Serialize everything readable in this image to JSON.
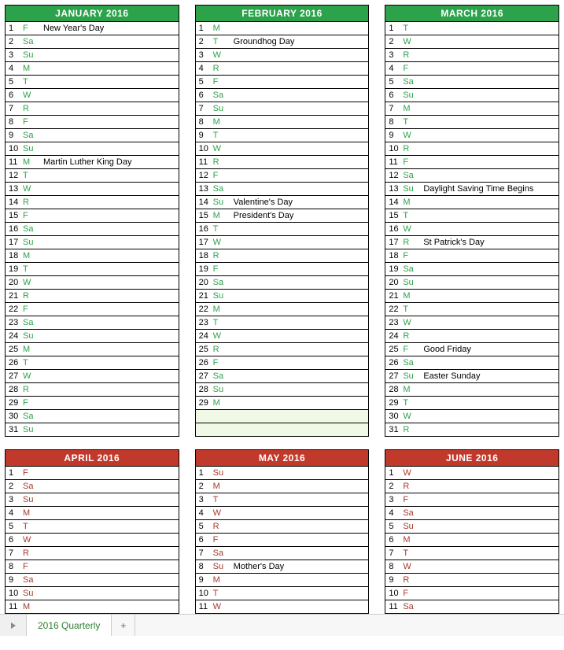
{
  "sheet_tab": "2016 Quarterly",
  "rows_q1": [
    {
      "top": [
        {
          "title": "JANUARY 2016",
          "hdr": "hdr-green",
          "wd": "wd-green",
          "fill": 31,
          "days": [
            {
              "n": 1,
              "w": "F",
              "e": "New Year's Day"
            },
            {
              "n": 2,
              "w": "Sa",
              "e": ""
            },
            {
              "n": 3,
              "w": "Su",
              "e": ""
            },
            {
              "n": 4,
              "w": "M",
              "e": ""
            },
            {
              "n": 5,
              "w": "T",
              "e": ""
            },
            {
              "n": 6,
              "w": "W",
              "e": ""
            },
            {
              "n": 7,
              "w": "R",
              "e": ""
            },
            {
              "n": 8,
              "w": "F",
              "e": ""
            },
            {
              "n": 9,
              "w": "Sa",
              "e": ""
            },
            {
              "n": 10,
              "w": "Su",
              "e": ""
            },
            {
              "n": 11,
              "w": "M",
              "e": "Martin Luther King Day"
            },
            {
              "n": 12,
              "w": "T",
              "e": ""
            },
            {
              "n": 13,
              "w": "W",
              "e": ""
            },
            {
              "n": 14,
              "w": "R",
              "e": ""
            },
            {
              "n": 15,
              "w": "F",
              "e": ""
            },
            {
              "n": 16,
              "w": "Sa",
              "e": ""
            },
            {
              "n": 17,
              "w": "Su",
              "e": ""
            },
            {
              "n": 18,
              "w": "M",
              "e": ""
            },
            {
              "n": 19,
              "w": "T",
              "e": ""
            },
            {
              "n": 20,
              "w": "W",
              "e": ""
            },
            {
              "n": 21,
              "w": "R",
              "e": ""
            },
            {
              "n": 22,
              "w": "F",
              "e": ""
            },
            {
              "n": 23,
              "w": "Sa",
              "e": ""
            },
            {
              "n": 24,
              "w": "Su",
              "e": ""
            },
            {
              "n": 25,
              "w": "M",
              "e": ""
            },
            {
              "n": 26,
              "w": "T",
              "e": ""
            },
            {
              "n": 27,
              "w": "W",
              "e": ""
            },
            {
              "n": 28,
              "w": "R",
              "e": ""
            },
            {
              "n": 29,
              "w": "F",
              "e": ""
            },
            {
              "n": 30,
              "w": "Sa",
              "e": ""
            },
            {
              "n": 31,
              "w": "Su",
              "e": ""
            }
          ]
        },
        {
          "title": "FEBRUARY 2016",
          "hdr": "hdr-green",
          "wd": "wd-green",
          "fill": 31,
          "days": [
            {
              "n": 1,
              "w": "M",
              "e": ""
            },
            {
              "n": 2,
              "w": "T",
              "e": "Groundhog Day"
            },
            {
              "n": 3,
              "w": "W",
              "e": ""
            },
            {
              "n": 4,
              "w": "R",
              "e": ""
            },
            {
              "n": 5,
              "w": "F",
              "e": ""
            },
            {
              "n": 6,
              "w": "Sa",
              "e": ""
            },
            {
              "n": 7,
              "w": "Su",
              "e": ""
            },
            {
              "n": 8,
              "w": "M",
              "e": ""
            },
            {
              "n": 9,
              "w": "T",
              "e": ""
            },
            {
              "n": 10,
              "w": "W",
              "e": ""
            },
            {
              "n": 11,
              "w": "R",
              "e": ""
            },
            {
              "n": 12,
              "w": "F",
              "e": ""
            },
            {
              "n": 13,
              "w": "Sa",
              "e": ""
            },
            {
              "n": 14,
              "w": "Su",
              "e": "Valentine's Day"
            },
            {
              "n": 15,
              "w": "M",
              "e": "President's Day"
            },
            {
              "n": 16,
              "w": "T",
              "e": ""
            },
            {
              "n": 17,
              "w": "W",
              "e": ""
            },
            {
              "n": 18,
              "w": "R",
              "e": ""
            },
            {
              "n": 19,
              "w": "F",
              "e": ""
            },
            {
              "n": 20,
              "w": "Sa",
              "e": ""
            },
            {
              "n": 21,
              "w": "Su",
              "e": ""
            },
            {
              "n": 22,
              "w": "M",
              "e": ""
            },
            {
              "n": 23,
              "w": "T",
              "e": ""
            },
            {
              "n": 24,
              "w": "W",
              "e": ""
            },
            {
              "n": 25,
              "w": "R",
              "e": ""
            },
            {
              "n": 26,
              "w": "F",
              "e": ""
            },
            {
              "n": 27,
              "w": "Sa",
              "e": ""
            },
            {
              "n": 28,
              "w": "Su",
              "e": ""
            },
            {
              "n": 29,
              "w": "M",
              "e": ""
            }
          ]
        },
        {
          "title": "MARCH 2016",
          "hdr": "hdr-green",
          "wd": "wd-green",
          "fill": 31,
          "days": [
            {
              "n": 1,
              "w": "T",
              "e": ""
            },
            {
              "n": 2,
              "w": "W",
              "e": ""
            },
            {
              "n": 3,
              "w": "R",
              "e": ""
            },
            {
              "n": 4,
              "w": "F",
              "e": ""
            },
            {
              "n": 5,
              "w": "Sa",
              "e": ""
            },
            {
              "n": 6,
              "w": "Su",
              "e": ""
            },
            {
              "n": 7,
              "w": "M",
              "e": ""
            },
            {
              "n": 8,
              "w": "T",
              "e": ""
            },
            {
              "n": 9,
              "w": "W",
              "e": ""
            },
            {
              "n": 10,
              "w": "R",
              "e": ""
            },
            {
              "n": 11,
              "w": "F",
              "e": ""
            },
            {
              "n": 12,
              "w": "Sa",
              "e": ""
            },
            {
              "n": 13,
              "w": "Su",
              "e": "Daylight Saving Time Begins"
            },
            {
              "n": 14,
              "w": "M",
              "e": ""
            },
            {
              "n": 15,
              "w": "T",
              "e": ""
            },
            {
              "n": 16,
              "w": "W",
              "e": ""
            },
            {
              "n": 17,
              "w": "R",
              "e": "St Patrick's Day"
            },
            {
              "n": 18,
              "w": "F",
              "e": ""
            },
            {
              "n": 19,
              "w": "Sa",
              "e": ""
            },
            {
              "n": 20,
              "w": "Su",
              "e": ""
            },
            {
              "n": 21,
              "w": "M",
              "e": ""
            },
            {
              "n": 22,
              "w": "T",
              "e": ""
            },
            {
              "n": 23,
              "w": "W",
              "e": ""
            },
            {
              "n": 24,
              "w": "R",
              "e": ""
            },
            {
              "n": 25,
              "w": "F",
              "e": "Good Friday"
            },
            {
              "n": 26,
              "w": "Sa",
              "e": ""
            },
            {
              "n": 27,
              "w": "Su",
              "e": "Easter Sunday"
            },
            {
              "n": 28,
              "w": "M",
              "e": ""
            },
            {
              "n": 29,
              "w": "T",
              "e": ""
            },
            {
              "n": 30,
              "w": "W",
              "e": ""
            },
            {
              "n": 31,
              "w": "R",
              "e": ""
            }
          ]
        }
      ]
    },
    {
      "top": [
        {
          "title": "APRIL 2016",
          "hdr": "hdr-red",
          "wd": "wd-red",
          "fill": 11,
          "days": [
            {
              "n": 1,
              "w": "F",
              "e": ""
            },
            {
              "n": 2,
              "w": "Sa",
              "e": ""
            },
            {
              "n": 3,
              "w": "Su",
              "e": ""
            },
            {
              "n": 4,
              "w": "M",
              "e": ""
            },
            {
              "n": 5,
              "w": "T",
              "e": ""
            },
            {
              "n": 6,
              "w": "W",
              "e": ""
            },
            {
              "n": 7,
              "w": "R",
              "e": ""
            },
            {
              "n": 8,
              "w": "F",
              "e": ""
            },
            {
              "n": 9,
              "w": "Sa",
              "e": ""
            },
            {
              "n": 10,
              "w": "Su",
              "e": ""
            },
            {
              "n": 11,
              "w": "M",
              "e": ""
            }
          ]
        },
        {
          "title": "MAY 2016",
          "hdr": "hdr-red",
          "wd": "wd-red",
          "fill": 11,
          "days": [
            {
              "n": 1,
              "w": "Su",
              "e": ""
            },
            {
              "n": 2,
              "w": "M",
              "e": ""
            },
            {
              "n": 3,
              "w": "T",
              "e": ""
            },
            {
              "n": 4,
              "w": "W",
              "e": ""
            },
            {
              "n": 5,
              "w": "R",
              "e": ""
            },
            {
              "n": 6,
              "w": "F",
              "e": ""
            },
            {
              "n": 7,
              "w": "Sa",
              "e": ""
            },
            {
              "n": 8,
              "w": "Su",
              "e": "Mother's Day"
            },
            {
              "n": 9,
              "w": "M",
              "e": ""
            },
            {
              "n": 10,
              "w": "T",
              "e": ""
            },
            {
              "n": 11,
              "w": "W",
              "e": ""
            }
          ]
        },
        {
          "title": "JUNE 2016",
          "hdr": "hdr-red",
          "wd": "wd-red",
          "fill": 11,
          "days": [
            {
              "n": 1,
              "w": "W",
              "e": ""
            },
            {
              "n": 2,
              "w": "R",
              "e": ""
            },
            {
              "n": 3,
              "w": "F",
              "e": ""
            },
            {
              "n": 4,
              "w": "Sa",
              "e": ""
            },
            {
              "n": 5,
              "w": "Su",
              "e": ""
            },
            {
              "n": 6,
              "w": "M",
              "e": ""
            },
            {
              "n": 7,
              "w": "T",
              "e": ""
            },
            {
              "n": 8,
              "w": "W",
              "e": ""
            },
            {
              "n": 9,
              "w": "R",
              "e": ""
            },
            {
              "n": 10,
              "w": "F",
              "e": ""
            },
            {
              "n": 11,
              "w": "Sa",
              "e": ""
            }
          ]
        }
      ]
    }
  ]
}
